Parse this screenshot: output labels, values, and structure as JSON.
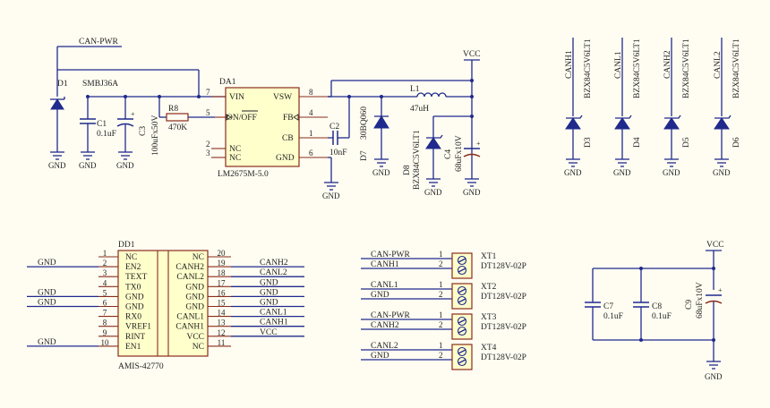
{
  "nets": {
    "can_pwr": "CAN-PWR",
    "vcc": "VCC",
    "gnd": "GND",
    "canh1": "CANH1",
    "canl1": "CANL1",
    "canh2": "CANH2",
    "canl2": "CANL2"
  },
  "regulator": {
    "ref": "DA1",
    "part": "LM2675M-5.0",
    "pins": [
      {
        "num": "7",
        "name": "VIN"
      },
      {
        "num": "5",
        "name": "ON/OFF"
      },
      {
        "num": "2",
        "name": "NC"
      },
      {
        "num": "3",
        "name": "NC"
      },
      {
        "num": "8",
        "name": "VSW"
      },
      {
        "num": "4",
        "name": "FB"
      },
      {
        "num": "1",
        "name": "CB"
      },
      {
        "num": "6",
        "name": "GND"
      }
    ]
  },
  "components": {
    "d1": {
      "ref": "D1",
      "value": "SMBJ36A"
    },
    "c1": {
      "ref": "C1",
      "value": "0.1uF"
    },
    "c3": {
      "ref": "C3",
      "value": "100uFx50V"
    },
    "r8": {
      "ref": "R8",
      "value": "470K"
    },
    "c2": {
      "ref": "C2",
      "value": "10nF"
    },
    "d7": {
      "ref": "D7",
      "value": "30BQ060"
    },
    "l1": {
      "ref": "L1",
      "value": "47uH"
    },
    "d8": {
      "ref": "D8",
      "value": "BZX84C5V6LT1"
    },
    "c4": {
      "ref": "C4",
      "value": "68uFx10V"
    },
    "c7": {
      "ref": "C7",
      "value": "0.1uF"
    },
    "c8": {
      "ref": "C8",
      "value": "0.1uF"
    },
    "c9": {
      "ref": "C9",
      "value": "68uFx10V"
    }
  },
  "tvs": [
    {
      "net": "CANH1",
      "ref": "D3",
      "value": "BZX84C5V6LT1"
    },
    {
      "net": "CANL1",
      "ref": "D4",
      "value": "BZX84C5V6LT1"
    },
    {
      "net": "CANH2",
      "ref": "D5",
      "value": "BZX84C5V6LT1"
    },
    {
      "net": "CANL2",
      "ref": "D6",
      "value": "BZX84C5V6LT1"
    }
  ],
  "transceiver": {
    "ref": "DD1",
    "part": "AMIS-42770",
    "left_pins": [
      {
        "num": "1",
        "name": "NC",
        "net": ""
      },
      {
        "num": "2",
        "name": "EN2",
        "net": "GND"
      },
      {
        "num": "3",
        "name": "TEXT",
        "net": ""
      },
      {
        "num": "4",
        "name": "TX0",
        "net": ""
      },
      {
        "num": "5",
        "name": "GND",
        "net": "GND"
      },
      {
        "num": "6",
        "name": "GND",
        "net": "GND"
      },
      {
        "num": "7",
        "name": "RX0",
        "net": ""
      },
      {
        "num": "8",
        "name": "VREF1",
        "net": ""
      },
      {
        "num": "9",
        "name": "RINT",
        "net": ""
      },
      {
        "num": "10",
        "name": "EN1",
        "net": "GND"
      }
    ],
    "right_pins": [
      {
        "num": "20",
        "name": "NC",
        "net": ""
      },
      {
        "num": "19",
        "name": "CANH2",
        "net": "CANH2"
      },
      {
        "num": "18",
        "name": "CANL2",
        "net": "CANL2"
      },
      {
        "num": "17",
        "name": "GND",
        "net": "GND"
      },
      {
        "num": "16",
        "name": "GND",
        "net": "GND"
      },
      {
        "num": "15",
        "name": "GND",
        "net": "GND"
      },
      {
        "num": "14",
        "name": "CANL1",
        "net": "CANL1"
      },
      {
        "num": "13",
        "name": "CANH1",
        "net": "CANH1"
      },
      {
        "num": "12",
        "name": "VCC",
        "net": "VCC"
      },
      {
        "num": "11",
        "name": "NC",
        "net": ""
      }
    ]
  },
  "connectors": [
    {
      "ref": "XT1",
      "part": "DT128V-02P",
      "nets": [
        "CAN-PWR",
        "CANH1"
      ]
    },
    {
      "ref": "XT2",
      "part": "DT128V-02P",
      "nets": [
        "CANL1",
        "GND"
      ]
    },
    {
      "ref": "XT3",
      "part": "DT128V-02P",
      "nets": [
        "CAN-PWR",
        "CANH2"
      ]
    },
    {
      "ref": "XT4",
      "part": "DT128V-02P",
      "nets": [
        "CANL2",
        "GND"
      ]
    }
  ],
  "pin_nums": {
    "one": "1",
    "two": "2"
  }
}
